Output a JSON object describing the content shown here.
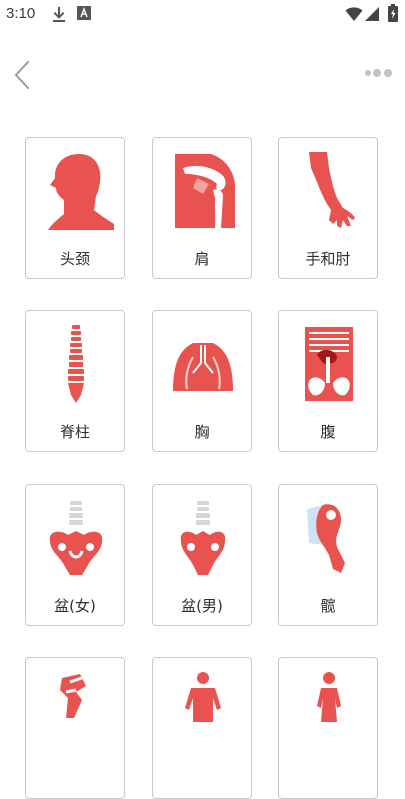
{
  "status_bar": {
    "time": "3:10",
    "icons": [
      "download-icon",
      "a-notification-icon",
      "wifi-icon",
      "signal-icon",
      "battery-icon"
    ]
  },
  "app_bar": {
    "back_icon": "chevron-left-icon",
    "more_icon": "more-dots-icon"
  },
  "colors": {
    "accent": "#e8534f",
    "bone": "#ffffff",
    "spine_gray": "#d6d6d6",
    "card_border": "#c9c9c9"
  },
  "categories": [
    {
      "label": "头颈",
      "icon": "head-neck-icon"
    },
    {
      "label": "肩",
      "icon": "shoulder-icon"
    },
    {
      "label": "手和肘",
      "icon": "arm-hand-icon"
    },
    {
      "label": "脊柱",
      "icon": "spine-icon"
    },
    {
      "label": "胸",
      "icon": "chest-lungs-icon"
    },
    {
      "label": "腹",
      "icon": "abdomen-icon"
    },
    {
      "label": "盆(女)",
      "icon": "female-pelvis-icon"
    },
    {
      "label": "盆(男)",
      "icon": "male-pelvis-icon"
    },
    {
      "label": "髋",
      "icon": "hip-icon"
    },
    {
      "label": "",
      "icon": "knee-icon"
    },
    {
      "label": "",
      "icon": "body-male-icon"
    },
    {
      "label": "",
      "icon": "body-female-icon"
    }
  ]
}
